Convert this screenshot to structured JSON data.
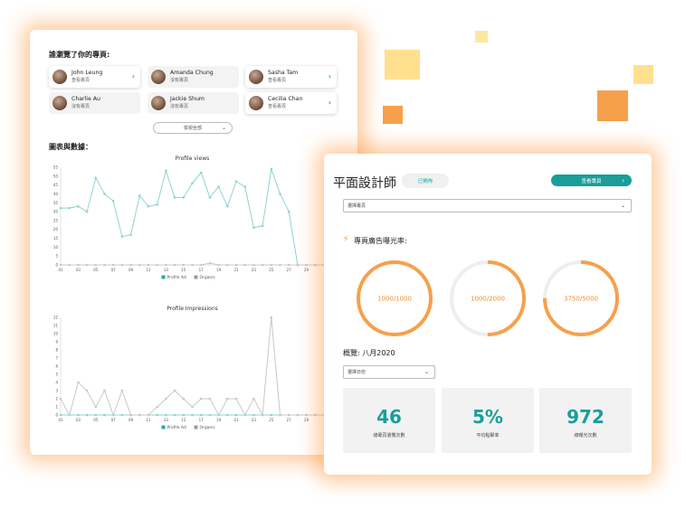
{
  "left_panel": {
    "viewers_title": "誰瀏覽了你的專頁:",
    "viewers": [
      {
        "name": "John Leung",
        "sub": "查看專頁",
        "chevron": "›"
      },
      {
        "name": "Amanda Chung",
        "sub": "沒有專頁",
        "chevron": ""
      },
      {
        "name": "Sasha Tam",
        "sub": "查看專頁",
        "chevron": "›"
      },
      {
        "name": "Charlie Au",
        "sub": "沒有專頁",
        "chevron": ""
      },
      {
        "name": "Jackie Shum",
        "sub": "沒有專頁",
        "chevron": ""
      },
      {
        "name": "Cecilia Chan",
        "sub": "查看專頁",
        "chevron": "›"
      }
    ],
    "show_all_label": "檢視全部",
    "charts_title": "圖表與數據："
  },
  "chart_data": [
    {
      "type": "line",
      "title": "Profile views",
      "x_ticks": [
        "01",
        "03",
        "05",
        "07",
        "09",
        "11",
        "13",
        "15",
        "17",
        "19",
        "21",
        "23",
        "25",
        "27",
        "29"
      ],
      "y_ticks": [
        0,
        5,
        10,
        15,
        20,
        25,
        30,
        35,
        40,
        45,
        50,
        55
      ],
      "ylim": [
        0,
        55
      ],
      "series": [
        {
          "name": "Profile Ad",
          "color": "#8fd3d3",
          "values": [
            32,
            32,
            33,
            30,
            49,
            40,
            36,
            16,
            17,
            39,
            33,
            34,
            53,
            38,
            38,
            46,
            52,
            38,
            44,
            33,
            47,
            44,
            21,
            22,
            54,
            40,
            30,
            0,
            0,
            0,
            0
          ]
        },
        {
          "name": "Organic",
          "color": "#c8c8c8",
          "values": [
            0,
            0,
            0,
            0,
            0,
            0,
            0,
            0,
            0,
            0,
            0,
            0,
            0,
            0,
            0,
            0,
            0,
            1,
            0,
            0,
            0,
            0,
            0,
            0,
            0,
            0,
            0,
            0,
            0,
            0,
            0
          ]
        }
      ]
    },
    {
      "type": "line",
      "title": "Profile Impressions",
      "x_ticks": [
        "01",
        "03",
        "05",
        "07",
        "09",
        "11",
        "13",
        "15",
        "17",
        "19",
        "21",
        "23",
        "25",
        "27",
        "29"
      ],
      "y_ticks": [
        0,
        1,
        2,
        3,
        4,
        5,
        6,
        7,
        8,
        9,
        10,
        11,
        12
      ],
      "ylim": [
        0,
        12
      ],
      "series": [
        {
          "name": "Profile Ad",
          "color": "#8fd3d3",
          "values": [
            0,
            0,
            0,
            0,
            0,
            0,
            0,
            0,
            0,
            0,
            0,
            0,
            0,
            0,
            0,
            0,
            0,
            0,
            0,
            0,
            0,
            0,
            0,
            0,
            0,
            0,
            0,
            0,
            0,
            0,
            0
          ]
        },
        {
          "name": "Organic",
          "color": "#c8c8c8",
          "values": [
            2,
            0,
            4,
            3,
            1,
            3,
            0,
            3,
            0,
            0,
            0,
            1,
            2,
            3,
            2,
            1,
            2,
            2,
            0,
            2,
            2,
            0,
            2,
            0,
            12,
            0,
            0,
            0,
            0,
            0,
            0
          ]
        }
      ]
    }
  ],
  "right_panel": {
    "job_title": "平面設計師",
    "status": "已開佈",
    "view_page_button": "查看專頁",
    "select_page": "選擇專頁",
    "exposure_title": "專頁廣告曝光率:",
    "gauges": [
      {
        "label": "1000/1000",
        "fraction": 1.0
      },
      {
        "label": "1000/2000",
        "fraction": 0.5
      },
      {
        "label": "3750/5000",
        "fraction": 0.75
      }
    ],
    "overview_title": "概覽: 八月2020",
    "select_period": "選擇日份",
    "stats": [
      {
        "value": "46",
        "label": "總專頁瀏覽次數"
      },
      {
        "value": "5%",
        "label": "平均點擊率"
      },
      {
        "value": "972",
        "label": "總曝光次數"
      }
    ]
  },
  "colors": {
    "accent_orange": "#f7a04b",
    "accent_teal": "#1a9e9a",
    "pale_yellow": "#ffe08f"
  }
}
